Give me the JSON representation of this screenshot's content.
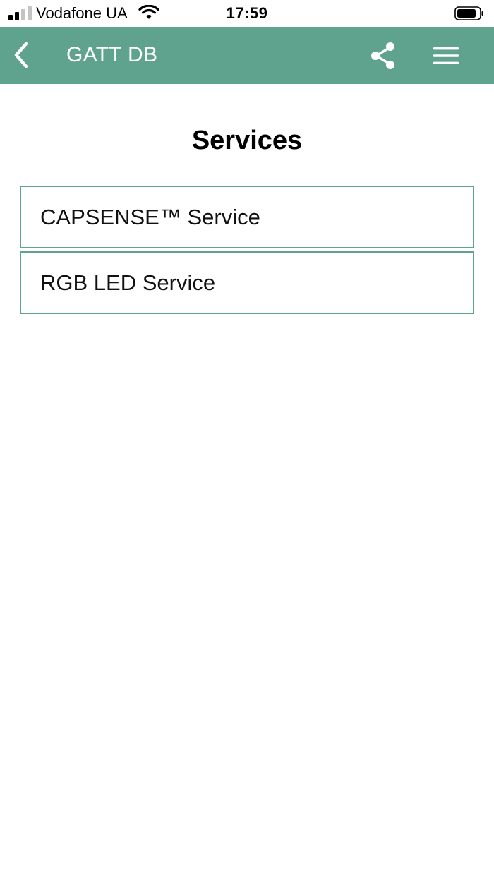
{
  "status_bar": {
    "carrier": "Vodafone UA",
    "time": "17:59",
    "signal_bars_active": 2,
    "signal_bars_total": 4
  },
  "app_bar": {
    "title": "GATT DB",
    "background_color": "#5fa38e",
    "back_icon": "chevron-left-icon",
    "share_icon": "share-icon",
    "menu_icon": "hamburger-menu-icon"
  },
  "main": {
    "section_title": "Services",
    "services": [
      {
        "label": "CAPSENSE™ Service"
      },
      {
        "label": "RGB LED Service"
      }
    ]
  }
}
